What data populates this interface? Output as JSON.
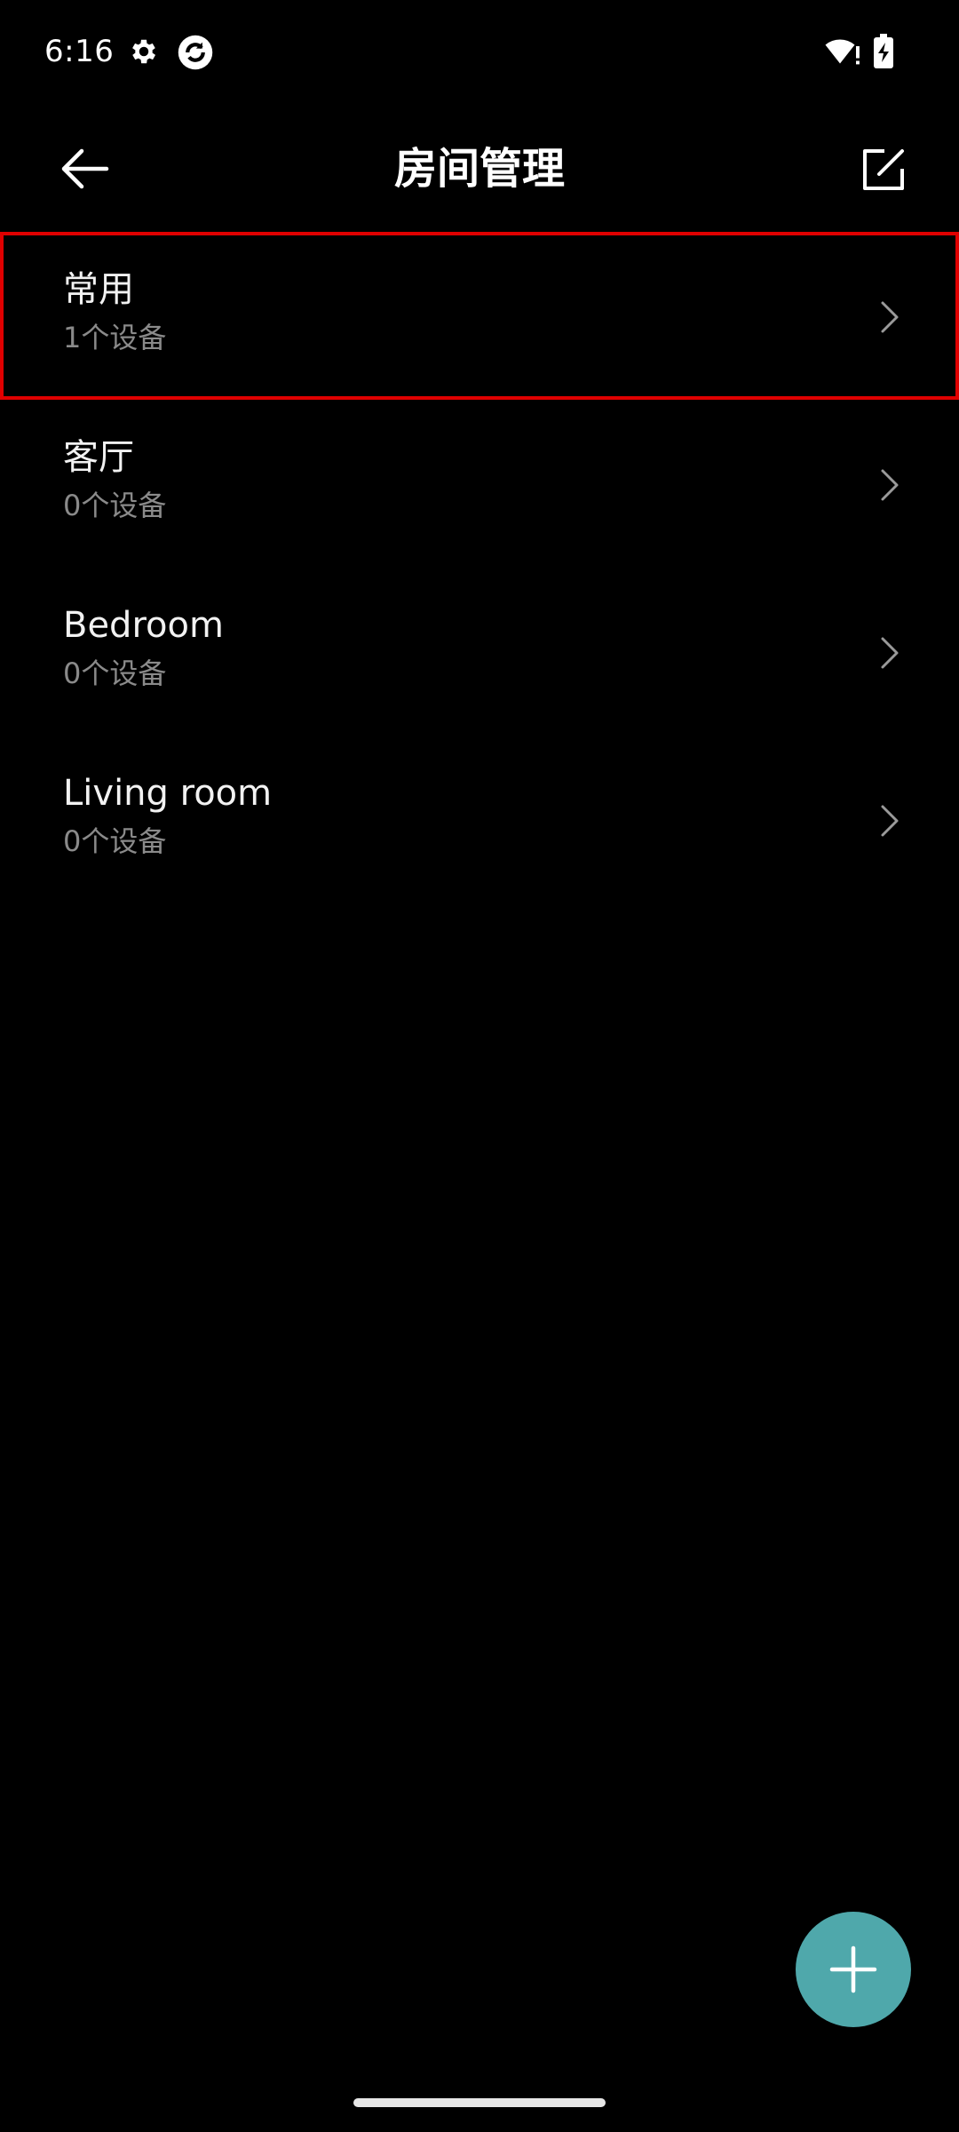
{
  "status_bar": {
    "time": "6:16",
    "icons": [
      "gear-icon",
      "app-sync-icon",
      "wifi-alert-icon",
      "battery-charging-icon"
    ]
  },
  "header": {
    "title": "房间管理",
    "back_icon": "arrow-left-icon",
    "edit_icon": "edit-icon"
  },
  "rooms": [
    {
      "name": "常用",
      "count": "1个设备",
      "selected": true
    },
    {
      "name": "客厅",
      "count": "0个设备",
      "selected": false
    },
    {
      "name": "Bedroom",
      "count": "0个设备",
      "selected": false
    },
    {
      "name": "Living room",
      "count": "0个设备",
      "selected": false
    }
  ],
  "fab": {
    "icon": "plus-icon"
  },
  "colors": {
    "background": "#000000",
    "accent": "#4fa8ab",
    "selection_border": "#e00000",
    "secondary_text": "#8a8a8a"
  }
}
